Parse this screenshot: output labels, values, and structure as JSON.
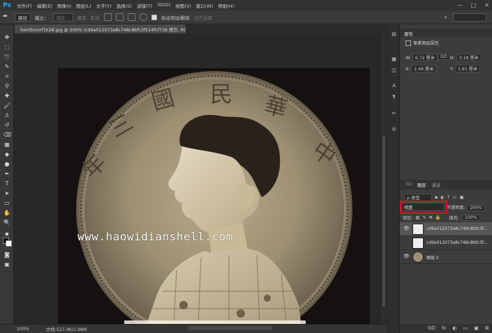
{
  "app": {
    "logo": "Ps"
  },
  "menu": [
    "文件(F)",
    "编辑(E)",
    "图像(I)",
    "图层(L)",
    "文字(Y)",
    "选择(S)",
    "滤镜(T)",
    "3D(D)",
    "视图(V)",
    "窗口(W)",
    "帮助(H)"
  ],
  "window_controls": {
    "minimize": "—",
    "maximize": "□",
    "close": "✕"
  },
  "options_bar": {
    "path_mode": "路径",
    "build_label": "建立：",
    "selection_label": "选区...",
    "mask_label": "蒙版",
    "shape_label": "形状",
    "auto_add_delete": "自动添加/删除",
    "align_edges": "对齐边缘"
  },
  "document": {
    "tab_title": "5entbmvrf1k28.jpg @ 200% (cd9a012073a8c748c8bfc3f514fcf736 拷贝, RGB/8#) *",
    "watermark": "www.haowidianshell.com",
    "coin_chars": [
      "中",
      "華",
      "民",
      "國",
      "三",
      "年"
    ]
  },
  "status_bar": {
    "zoom": "200%",
    "doc_info": "文档:527.4K/1.98M"
  },
  "properties": {
    "title": "属性",
    "subtitle": "像素图层属性",
    "w_label": "W:",
    "w_value": "6.72 厘米",
    "link_label": "GO",
    "h_label": "H:",
    "h_value": "3.18 厘米",
    "x_label": "X:",
    "x_value": "2.49 厘米",
    "y_label": "Y:",
    "y_value": "1.91 厘米"
  },
  "layers": {
    "tabs": [
      "3D",
      "图层",
      "通道"
    ],
    "active_tab": "图层",
    "filter_label": "ρ 类型",
    "blend_mode": "明度",
    "opacity_label": "不透明度:",
    "opacity_value": "100%",
    "lock_label": "锁定:",
    "fill_label": "填充:",
    "fill_value": "100%",
    "items": [
      {
        "name": "cd9a012073a8c748c8bfc3f...",
        "visible": "👁",
        "selected": true
      },
      {
        "name": "cd9a012073a8c748c8bfc3f...",
        "visible": "",
        "selected": false
      },
      {
        "name": "图层 0",
        "visible": "👁",
        "selected": false
      }
    ],
    "footer_icons": [
      "GO",
      "fx",
      "◐",
      "▭",
      "▣",
      "⊞",
      "🗑"
    ]
  },
  "colors": {
    "accent": "#31a8ff",
    "highlight_box": "#d9141e",
    "canvas_bg": "#282828"
  }
}
